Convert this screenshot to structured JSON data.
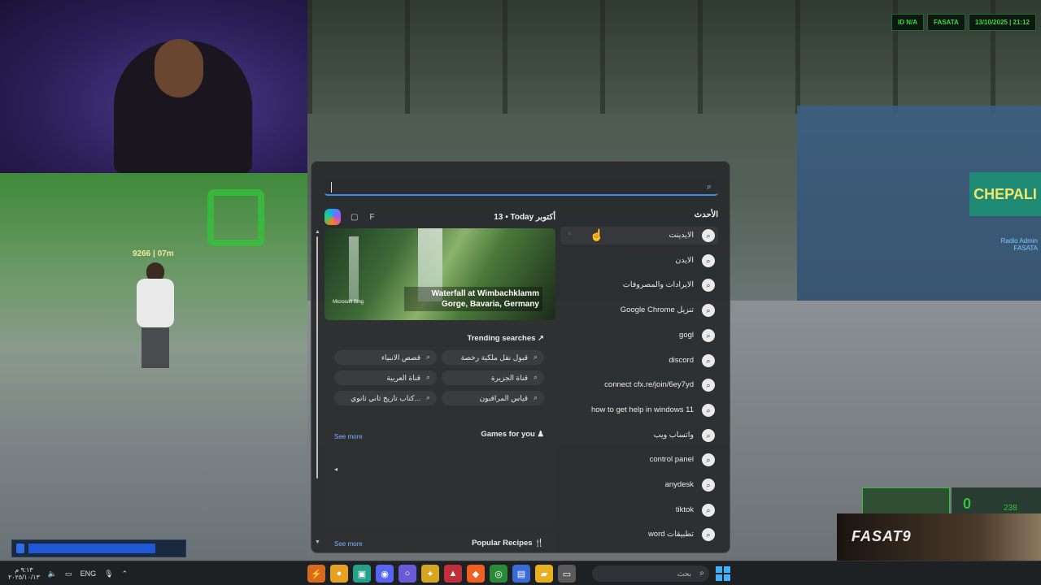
{
  "hud": {
    "id": "ID N/A",
    "name": "FASATA",
    "datetime": "13/10/2025 | 21:12"
  },
  "nametag": "9266 | 07m",
  "radio": {
    "line1": "Radio Admin",
    "line2": "FASATA"
  },
  "ammo": {
    "clip": "0",
    "total": "238"
  },
  "health_fraction": 0.78,
  "brand": "FASAT9",
  "search": {
    "placeholder": ""
  },
  "panel": {
    "today_label": "13 • Today أكتوبر",
    "profile_initial": "F",
    "hero": {
      "title": "Waterfall at Wimbachklamm Gorge, Bavaria, Germany",
      "credit": "Microsoft Bing"
    },
    "trending": {
      "title": "Trending searches",
      "chips": [
        "قبول نقل ملكية رخصة",
        "قصص الانبياء",
        "قناة الجزيرة",
        "قناة العربية",
        "قياس المراقبون",
        "كتاب تاريخ ثاني ثانوي..."
      ]
    },
    "games": {
      "title": "Games for you",
      "see_more": "See more"
    },
    "recipes": {
      "title": "Popular Recipes",
      "see_more": "See more"
    },
    "recent": {
      "title": "الأحدث",
      "items": [
        "الايدينت",
        "الايدن",
        "الايرادات والمصروفات",
        "Google Chrome تنزيل",
        "gogl",
        "discord",
        "connect cfx.re/join/6ey7yd",
        "how to get help in windows 11",
        "واتساب ويب",
        "control panel",
        "anydesk",
        "tiktok",
        "word تطبيقات"
      ]
    }
  },
  "taskbar": {
    "lang": "ENG",
    "clock_time": "٩:١٣ م",
    "clock_date": "٢٠٢٥/١٠/١٣",
    "search_placeholder": "بحث"
  },
  "colors": {
    "accent": "#3a8ee6",
    "hud_green": "#3bdc3b",
    "health_blue": "#1e58d6"
  }
}
